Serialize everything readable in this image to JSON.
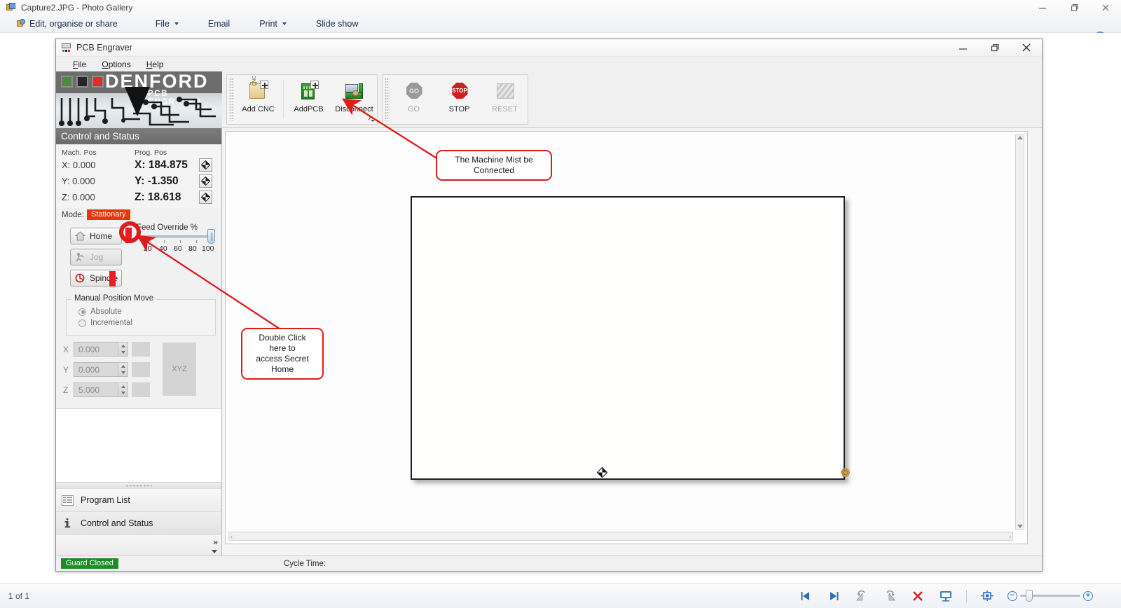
{
  "photo_gallery": {
    "title": "Capture2.JPG - Photo Gallery",
    "title_icon": "photo-gallery-icon",
    "menu": [
      {
        "label": "Edit, organise or share",
        "icon": "photo-edit-icon",
        "dropdown": false
      },
      {
        "label": "File",
        "icon": "",
        "dropdown": true
      },
      {
        "label": "Email",
        "icon": "",
        "dropdown": false
      },
      {
        "label": "Print",
        "icon": "",
        "dropdown": true
      },
      {
        "label": "Slide show",
        "icon": "",
        "dropdown": false
      }
    ],
    "help_glyph": "?",
    "window_buttons": [
      "minimize",
      "restore",
      "close"
    ],
    "count_label": "1 of 1",
    "bottom_tools": [
      "previous-icon",
      "next-icon",
      "rotate-left-icon",
      "rotate-right-icon",
      "delete-icon",
      "slideshow-icon",
      "fit-to-window-icon"
    ],
    "zoom": {
      "minus": "−",
      "plus": "+"
    }
  },
  "pcb_window": {
    "title": "PCB Engraver",
    "title_icon": "pcb-engraver-icon",
    "window_buttons": [
      "minimize",
      "restore",
      "close"
    ],
    "menus": [
      {
        "label": "File",
        "accel": "F"
      },
      {
        "label": "Options",
        "accel": "O"
      },
      {
        "label": "Help",
        "accel": "H"
      }
    ],
    "logo": {
      "brand": "DENFORD",
      "sub": "PCB ENGRAVER"
    },
    "toolbar": {
      "group1": [
        {
          "label": "Add CNC",
          "icon": "add-cnc-icon",
          "disabled": false
        },
        {
          "label": "AddPCB",
          "icon": "add-pcb-icon",
          "disabled": false
        },
        {
          "label": "Disconnect",
          "icon": "disconnect-icon",
          "disabled": false
        }
      ],
      "group2": [
        {
          "label": "GO",
          "icon": "go-icon",
          "disabled": true
        },
        {
          "label": "STOP",
          "icon": "stop-icon",
          "disabled": false
        },
        {
          "label": "RESET",
          "icon": "reset-icon",
          "disabled": true
        }
      ]
    },
    "control_status": {
      "header": "Control and Status",
      "col_headers": {
        "machine": "Mach. Pos",
        "program": "Prog. Pos"
      },
      "axes": [
        {
          "name": "X",
          "machine": "X: 0.000",
          "program": "X: 184.875",
          "datum_icon": "datum-icon"
        },
        {
          "name": "Y",
          "machine": "Y: 0.000",
          "program": "Y: -1.350",
          "datum_icon": "datum-icon"
        },
        {
          "name": "Z",
          "machine": "Z: 0.000",
          "program": "Z: 18.618",
          "datum_icon": "datum-icon"
        }
      ],
      "mode_label": "Mode:",
      "mode_value": "Stationary",
      "mode_color": "#e8350e",
      "buttons": [
        {
          "label": "Home",
          "icon": "home-icon",
          "disabled": false
        },
        {
          "label": "Jog",
          "icon": "jog-icon",
          "disabled": true
        },
        {
          "label": "Spindle",
          "icon": "spindle-icon",
          "disabled": false
        }
      ],
      "feed_override": {
        "label": "Feed Override %",
        "ticks": [
          "20",
          "40",
          "60",
          "80",
          "100"
        ],
        "value": 100
      },
      "manual_position_move": {
        "title": "Manual Position Move",
        "options": [
          {
            "label": "Absolute",
            "selected": true
          },
          {
            "label": "Incremental",
            "selected": false
          }
        ],
        "fields": [
          {
            "axis": "X",
            "value": "0.000"
          },
          {
            "axis": "Y",
            "value": "0.000"
          },
          {
            "axis": "Z",
            "value": "5.000"
          }
        ],
        "xyz_button": "XYZ"
      }
    },
    "nav_items": [
      {
        "label": "Program List",
        "icon": "program-list-icon",
        "selected": false
      },
      {
        "label": "Control and Status",
        "icon": "info-icon",
        "selected": true
      }
    ],
    "statusbar": {
      "guard": "Guard Closed",
      "guard_color": "#1f8c2a",
      "cycle_time": "Cycle Time:"
    }
  },
  "annotations": {
    "accent_color": "#e01b1b",
    "callouts": [
      {
        "id": "machine-connected",
        "text": "The Machine Mist be Connected"
      },
      {
        "id": "secret-home",
        "line1": "Double Click here to",
        "line2": "access Secret Home"
      }
    ]
  }
}
